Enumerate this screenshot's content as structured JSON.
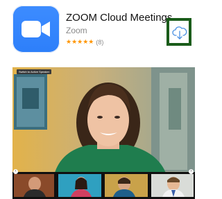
{
  "app": {
    "title": "ZOOM Cloud Meetings",
    "developer": "Zoom",
    "rating_stars": "★★★★★",
    "rating_value": 4.5,
    "rating_count": "(8)"
  },
  "icons": {
    "app_icon": "zoom-video-camera-icon",
    "download": "cloud-download-icon",
    "prev": "chevron-left-icon",
    "next": "chevron-right-icon"
  },
  "screenshot": {
    "switch_label": "Switch to Active Speaker",
    "prev_arrow": "‹",
    "next_arrow": "›"
  },
  "colors": {
    "app_icon_blue": "#2d7ffa",
    "star_orange": "#ff9500",
    "download_border": "#1a5c1a",
    "download_icon_blue": "#4a90e2"
  }
}
